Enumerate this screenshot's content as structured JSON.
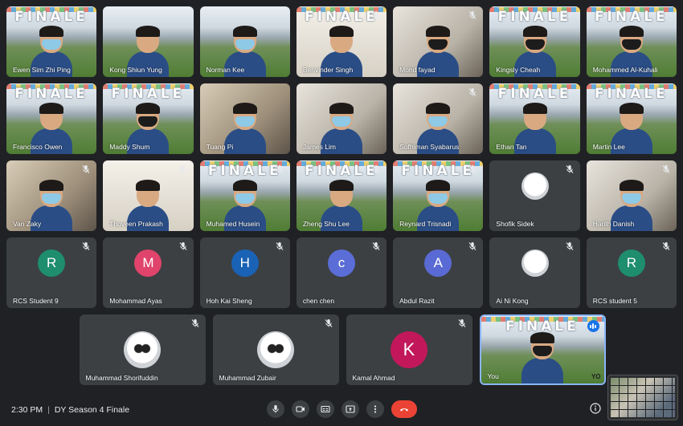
{
  "meeting": {
    "time": "2:30 PM",
    "separator": "|",
    "title": "DY Season 4 Finale"
  },
  "banner_text": "FINALE",
  "self_badge_text": "YO",
  "rows": [
    [
      {
        "name": "Ewen Sim Zhi Ping",
        "scene": "stadium",
        "banner": true,
        "muted": false,
        "mask": "blue"
      },
      {
        "name": "Kong Shiun Yung",
        "scene": "stadium",
        "banner": false,
        "muted": false,
        "mask": "none"
      },
      {
        "name": "Norman Kee",
        "scene": "stadium",
        "banner": false,
        "muted": false,
        "mask": "blue"
      },
      {
        "name": "Benvinder Singh",
        "scene": "light",
        "banner": true,
        "muted": true,
        "mask": "none"
      },
      {
        "name": "Mohd fayad",
        "scene": "room2",
        "banner": false,
        "muted": true,
        "mask": "black"
      },
      {
        "name": "Kingsly Cheah",
        "scene": "stadium",
        "banner": true,
        "muted": false,
        "mask": "black"
      },
      {
        "name": "Mohammed Al-Kuhali",
        "scene": "stadium",
        "banner": true,
        "muted": false,
        "mask": "black"
      }
    ],
    [
      {
        "name": "Francisco Owen",
        "scene": "stadium",
        "banner": true,
        "muted": false,
        "mask": "none"
      },
      {
        "name": "Maddy Shum",
        "scene": "stadium",
        "banner": true,
        "muted": false,
        "mask": "black"
      },
      {
        "name": "Tuang Pi",
        "scene": "room",
        "banner": false,
        "muted": false,
        "mask": "blue"
      },
      {
        "name": "James Lim",
        "scene": "room2",
        "banner": false,
        "muted": false,
        "mask": "blue"
      },
      {
        "name": "Sofhiman Syabarus",
        "scene": "room2",
        "banner": false,
        "muted": true,
        "mask": "blue"
      },
      {
        "name": "Ethan Tan",
        "scene": "stadium",
        "banner": true,
        "muted": false,
        "mask": "none"
      },
      {
        "name": "Martin Lee",
        "scene": "stadium",
        "banner": true,
        "muted": false,
        "mask": "none"
      }
    ],
    [
      {
        "name": "Van Zaky",
        "scene": "room",
        "banner": false,
        "muted": true,
        "mask": "blue"
      },
      {
        "name": "Thoveen Prakash",
        "scene": "light",
        "banner": false,
        "muted": true,
        "mask": "none"
      },
      {
        "name": "Muhamed Husein",
        "scene": "stadium",
        "banner": true,
        "muted": true,
        "mask": "blue"
      },
      {
        "name": "Zheng Shu Lee",
        "scene": "stadium",
        "banner": true,
        "muted": true,
        "mask": "none"
      },
      {
        "name": "Reynard Trisnadi",
        "scene": "stadium",
        "banner": true,
        "muted": true,
        "mask": "blue"
      },
      {
        "name": "Shofik Sidek",
        "scene": "avatar",
        "avatar_letter": "",
        "avatar_color": "#ffffff",
        "muted": true
      },
      {
        "name": "Harith Danish",
        "scene": "room2",
        "banner": false,
        "muted": true,
        "mask": "blue"
      }
    ],
    [
      {
        "name": "RCS Student 9",
        "scene": "avatar",
        "avatar_letter": "R",
        "avatar_color": "#1e8e6e",
        "muted": true
      },
      {
        "name": "Mohammad Ayas",
        "scene": "avatar",
        "avatar_letter": "M",
        "avatar_color": "#e0436b",
        "muted": true
      },
      {
        "name": "Hoh Kai Sheng",
        "scene": "avatar",
        "avatar_letter": "H",
        "avatar_color": "#1a62b5",
        "muted": true
      },
      {
        "name": "chen chen",
        "scene": "avatar",
        "avatar_letter": "c",
        "avatar_color": "#5b6dd6",
        "muted": true
      },
      {
        "name": "Abdul Razit",
        "scene": "avatar",
        "avatar_letter": "A",
        "avatar_color": "#5a6ad4",
        "muted": true
      },
      {
        "name": "Ai Ni Kong",
        "scene": "avatar",
        "avatar_letter": "",
        "avatar_color": "#d8dadc",
        "muted": true
      },
      {
        "name": "RCS student 5",
        "scene": "avatar",
        "avatar_letter": "R",
        "avatar_color": "#1e8e6e",
        "muted": true
      }
    ],
    [
      {
        "name": "Muhammad Shorifuddin",
        "scene": "avatar",
        "avatar_letter": "",
        "avatar_color": "#ffffff",
        "muted": true
      },
      {
        "name": "Muhammad Zubair",
        "scene": "avatar",
        "avatar_letter": "",
        "avatar_color": "#ffffff",
        "muted": true
      },
      {
        "name": "Kamal Ahmad",
        "scene": "avatar",
        "avatar_letter": "K",
        "avatar_color": "#c2185b",
        "muted": true
      },
      {
        "name": "You",
        "scene": "stadium",
        "banner": true,
        "muted": false,
        "mask": "black",
        "self": true
      }
    ]
  ],
  "controls": [
    {
      "name": "mic-button",
      "icon": "mic-icon"
    },
    {
      "name": "camera-button",
      "icon": "camera-icon"
    },
    {
      "name": "captions-button",
      "icon": "captions-icon"
    },
    {
      "name": "present-button",
      "icon": "present-icon"
    },
    {
      "name": "more-options-button",
      "icon": "more-vert-icon"
    },
    {
      "name": "leave-call-button",
      "icon": "hang-up-icon"
    }
  ],
  "colors": {
    "background": "#202124",
    "tile": "#3c4043",
    "end_call": "#ea4335",
    "active_speaker": "#1a73e8"
  }
}
